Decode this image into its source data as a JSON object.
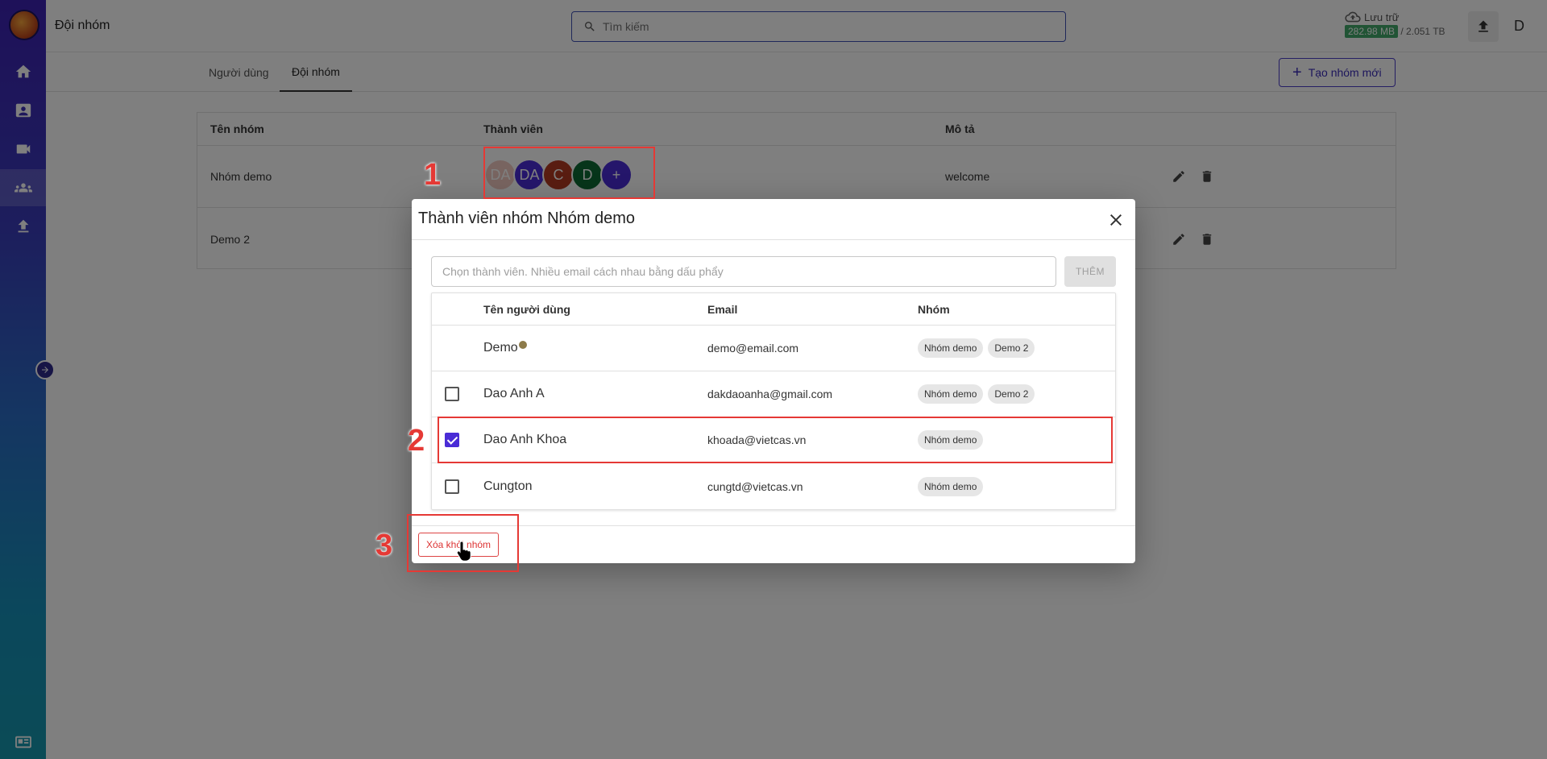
{
  "header": {
    "page_title": "Đội nhóm",
    "search_placeholder": "Tìm kiếm",
    "storage_label": "Lưu trữ",
    "storage_used": "282.98 MB",
    "storage_total": "/ 2.051 TB",
    "user_initial": "D"
  },
  "tabs": [
    {
      "label": "Người dùng",
      "active": false
    },
    {
      "label": "Đội nhóm",
      "active": true
    }
  ],
  "create_group_button": "Tạo nhóm mới",
  "groups_table": {
    "columns": [
      "Tên nhóm",
      "Thành viên",
      "Mô tả"
    ],
    "rows": [
      {
        "name": "Nhóm demo",
        "members": [
          "DA",
          "DA",
          "C",
          "D",
          "+"
        ],
        "description": "welcome"
      },
      {
        "name": "Demo 2",
        "members": [],
        "description": ""
      }
    ]
  },
  "avatar_colors": [
    "#f0c8c0",
    "#4a2cd6",
    "#b23a22",
    "#0f6b35",
    "#4a2cd6"
  ],
  "dialog": {
    "title": "Thành viên nhóm Nhóm demo",
    "input_placeholder": "Chọn thành viên. Nhiều email cách nhau bằng dấu phẩy",
    "add_button": "THÊM",
    "columns": [
      "Tên người dùng",
      "Email",
      "Nhóm"
    ],
    "members": [
      {
        "name": "Demo",
        "email": "demo@email.com",
        "groups": [
          "Nhóm demo",
          "Demo 2"
        ],
        "checkbox": false,
        "owner": true
      },
      {
        "name": "Dao Anh A",
        "email": "dakdaoanha@gmail.com",
        "groups": [
          "Nhóm demo",
          "Demo 2"
        ],
        "checkbox": true,
        "checked": false
      },
      {
        "name": "Dao Anh Khoa",
        "email": "khoada@vietcas.vn",
        "groups": [
          "Nhóm demo"
        ],
        "checkbox": true,
        "checked": true
      },
      {
        "name": "Cungton",
        "email": "cungtd@vietcas.vn",
        "groups": [
          "Nhóm demo"
        ],
        "checkbox": true,
        "checked": false
      }
    ],
    "remove_button": "Xóa khỏi nhóm"
  },
  "annotations": [
    "1",
    "2",
    "3"
  ]
}
